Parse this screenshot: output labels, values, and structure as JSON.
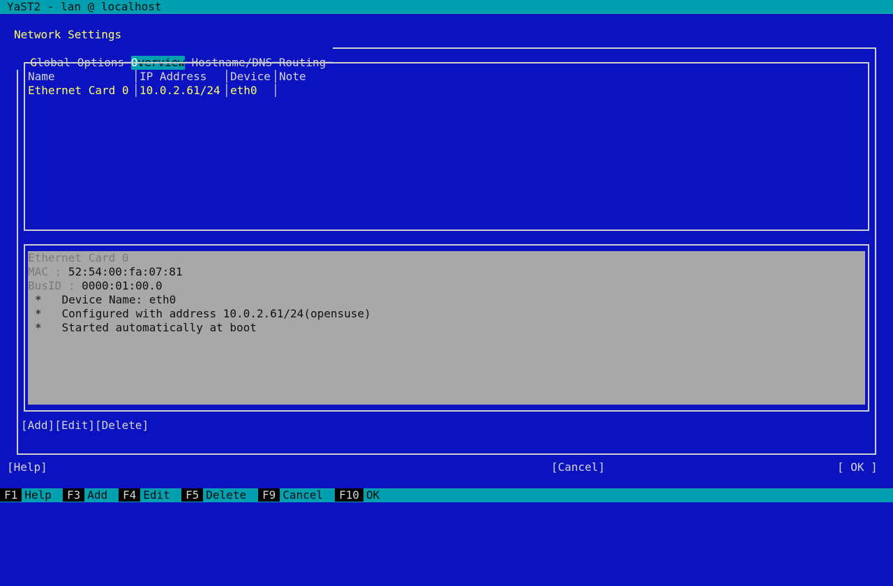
{
  "window": {
    "title": "YaST2 - lan @ localhost"
  },
  "dialog": {
    "title": "Network Settings",
    "tabs": [
      {
        "label": "Global Options",
        "active": false
      },
      {
        "label": "Overview",
        "active": true
      },
      {
        "label": "Hostname/DNS",
        "active": false
      },
      {
        "label": "Routing",
        "active": false
      }
    ]
  },
  "table": {
    "headers": [
      "Name",
      "IP Address",
      "Device",
      "Note"
    ],
    "rows": [
      {
        "name": "Ethernet Card 0",
        "ip": "10.0.2.61/24",
        "device": "eth0",
        "note": ""
      }
    ]
  },
  "details": {
    "title": "Ethernet Card 0",
    "mac_label": "MAC",
    "mac_value": "52:54:00:fa:07:81",
    "busid_label": "BusID",
    "busid_value": "0000:01:00.0",
    "bullets": [
      "Device Name: eth0",
      "Configured with address 10.0.2.61/24(opensuse)",
      "Started automatically at boot"
    ]
  },
  "actions": {
    "add": "Add",
    "edit": "Edit",
    "delete": "Delete"
  },
  "bottom_buttons": {
    "help": "Help",
    "cancel": "Cancel",
    "ok": "OK"
  },
  "fkeys": [
    {
      "key": "F1",
      "label": "Help"
    },
    {
      "key": "F3",
      "label": "Add"
    },
    {
      "key": "F4",
      "label": "Edit"
    },
    {
      "key": "F5",
      "label": "Delete"
    },
    {
      "key": "F9",
      "label": "Cancel"
    },
    {
      "key": "F10",
      "label": "OK"
    }
  ],
  "colors": {
    "background": "#0b12c0",
    "accent": "#00a0b0",
    "highlight": "#ffff66",
    "panel": "#a8a8a8"
  }
}
